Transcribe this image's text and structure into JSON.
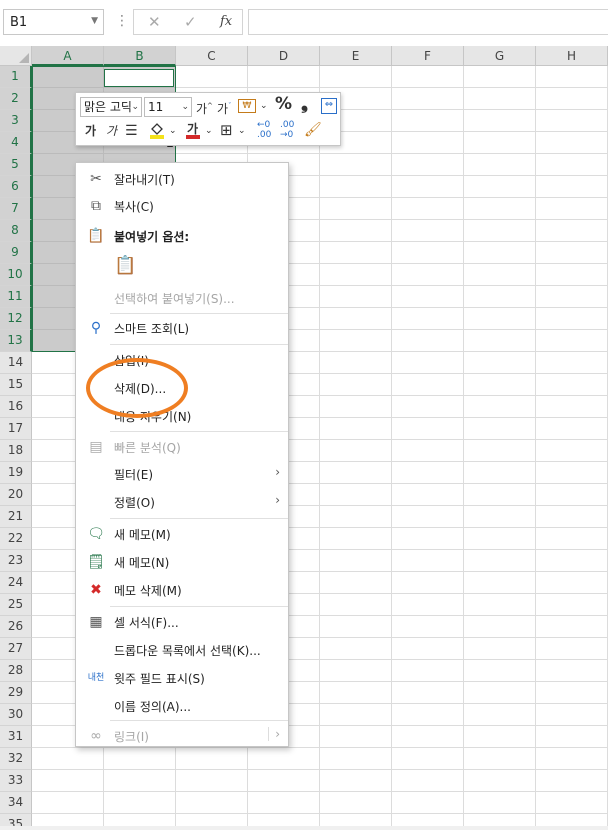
{
  "namebox": {
    "value": "B1"
  },
  "formula_bar": {
    "cancel": "✕",
    "enter": "✓",
    "fx": "fx",
    "content": ""
  },
  "columns": [
    "A",
    "B",
    "C",
    "D",
    "E",
    "F",
    "G",
    "H"
  ],
  "rows": [
    "1",
    "2",
    "3",
    "4",
    "5",
    "6",
    "7",
    "8",
    "9",
    "10",
    "11",
    "12",
    "13",
    "14",
    "15",
    "16",
    "17",
    "18",
    "19",
    "20",
    "21",
    "22",
    "23",
    "24",
    "25",
    "26",
    "27",
    "28",
    "29",
    "30",
    "31",
    "32",
    "33",
    "34",
    "35"
  ],
  "cell_value_b4": "2",
  "mini_toolbar": {
    "font_name": "맑은 고딕",
    "font_size": "11",
    "grow_font": "가",
    "shrink_font": "가",
    "percent": "%",
    "comma": "❟",
    "bold": "가",
    "italic": "가"
  },
  "context_menu": {
    "cut": "잘라내기(T)",
    "copy": "복사(C)",
    "paste_options": "붙여넣기 옵션:",
    "paste_special": "선택하여 붙여넣기(S)...",
    "smart_lookup": "스마트 조회(L)",
    "insert": "삽입(I)",
    "delete": "삭제(D)...",
    "clear_contents": "내용 지우기(N)",
    "quick_analysis": "빠른 분석(Q)",
    "filter": "필터(E)",
    "sort": "정렬(O)",
    "new_comment": "새 메모(M)",
    "new_note": "새 메모(N)",
    "delete_note": "메모 삭제(M)",
    "format_cells": "셀 서식(F)...",
    "pick_from_list": "드롭다운 목록에서 선택(K)...",
    "phonetic": "윗주 필드 표시(S)",
    "define_name": "이름 정의(A)...",
    "link": "링크(I)",
    "submenu_arrow": "›"
  },
  "colors": {
    "accent": "#217346",
    "highlight": "#ef7e22"
  }
}
